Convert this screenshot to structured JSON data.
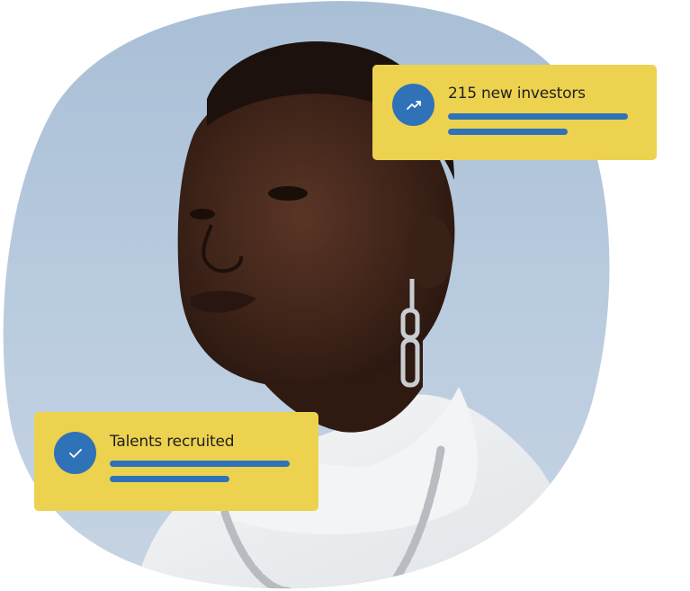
{
  "investors_card": {
    "title": "215 new investors",
    "icon": "trending-up-icon"
  },
  "talents_card": {
    "title": "Talents recruited",
    "icon": "checkmark-icon"
  },
  "colors": {
    "card_background": "#ecd24f",
    "accent_blue": "#2f72b8",
    "photo_background": "#b9cce0"
  }
}
